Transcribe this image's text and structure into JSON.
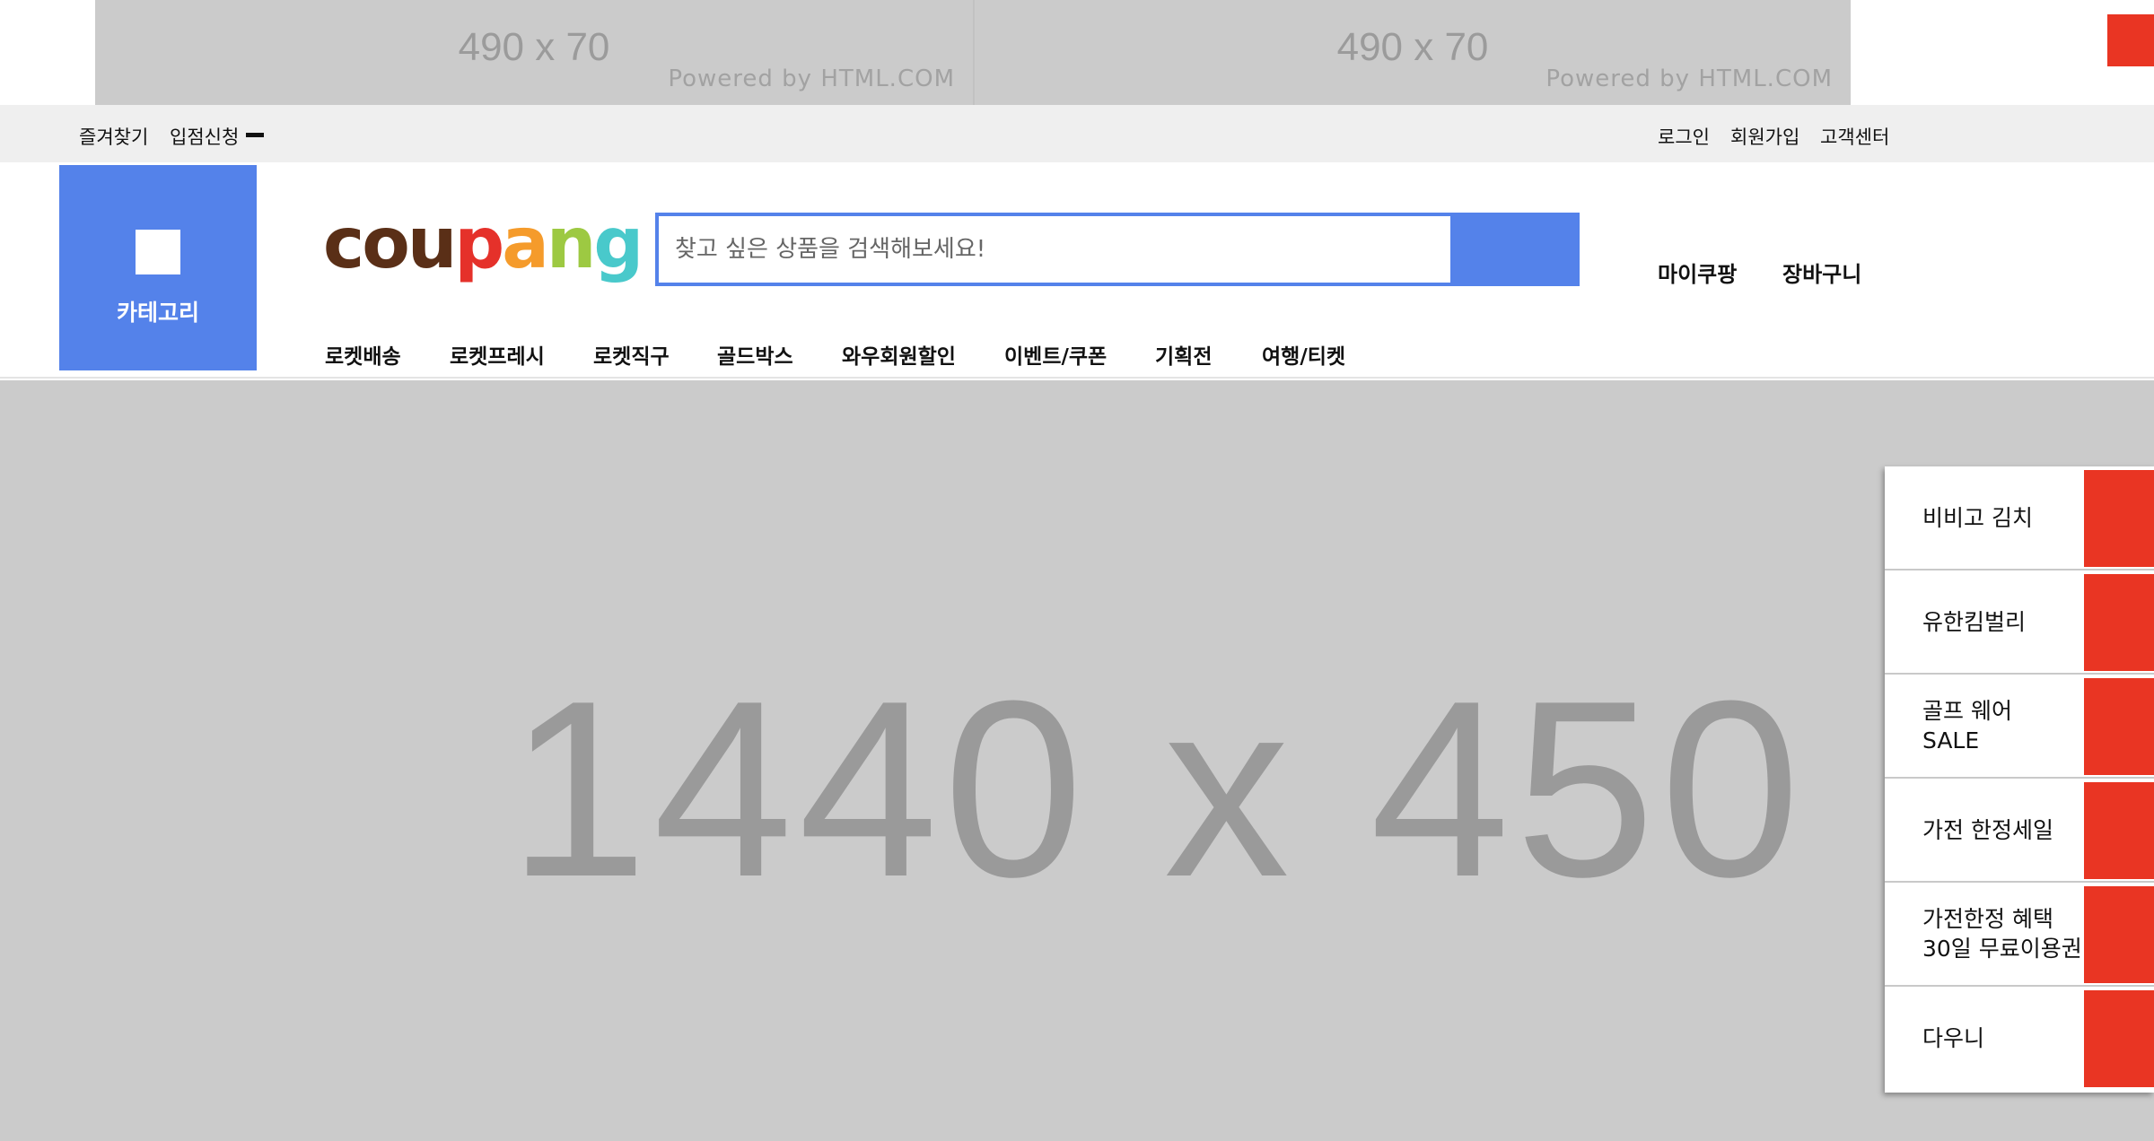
{
  "ads": [
    {
      "size_label": "490 x 70",
      "powered_label": "Powered by HTML.COM"
    },
    {
      "size_label": "490 x 70",
      "powered_label": "Powered by HTML.COM"
    }
  ],
  "utility": {
    "left": [
      "즐겨찾기",
      "입점신청"
    ],
    "right": [
      "로그인",
      "회원가입",
      "고객센터"
    ]
  },
  "header": {
    "category_label": "카테고리",
    "logo": [
      "c",
      "o",
      "u",
      "p",
      "a",
      "n",
      "g"
    ],
    "search_placeholder": "찾고 싶은 상품을 검색해보세요!",
    "links": [
      "마이쿠팡",
      "장바구니"
    ],
    "nav": [
      "로켓배송",
      "로켓프레시",
      "로켓직구",
      "골드박스",
      "와우회원할인",
      "이벤트/쿠폰",
      "기획전",
      "여행/티켓"
    ]
  },
  "hero": {
    "size_label": "1440 x 450"
  },
  "side_panel": [
    "비비고 김치",
    "유한킴벌리",
    "골프 웨어\nSALE",
    "가전 한정세일",
    "가전한정 혜택\n30일 무료이용권",
    "다우니"
  ],
  "colors": {
    "brand_blue": "#5482ea",
    "accent_red": "#e93523",
    "placeholder_gray": "#cbcbcb"
  }
}
